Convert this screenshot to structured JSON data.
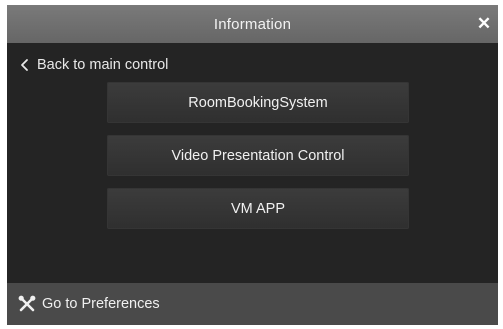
{
  "header": {
    "title": "Information",
    "close_icon": "close-icon"
  },
  "navigation": {
    "back_label": "Back to main control",
    "back_icon": "chevron-left-icon"
  },
  "apps": [
    {
      "label": "RoomBookingSystem"
    },
    {
      "label": "Video Presentation Control"
    },
    {
      "label": "VM APP"
    }
  ],
  "footer": {
    "label": "Go to Preferences",
    "icon": "tools-icon"
  },
  "colors": {
    "panel_background": "#242424",
    "title_bar": "#707070",
    "button_background": "#363636",
    "footer_background": "#4a4a4a",
    "text": "#f0f0f0"
  }
}
